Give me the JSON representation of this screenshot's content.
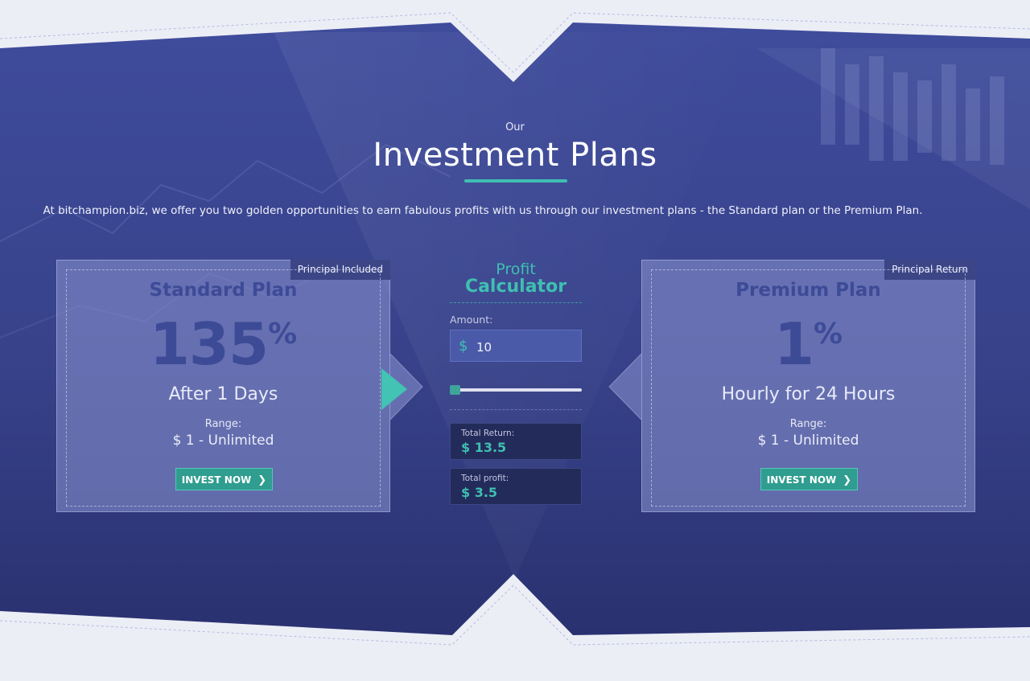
{
  "section": {
    "eyebrow": "Our",
    "title": "Investment Plans",
    "intro": "At bitchampion.biz, we offer you two golden opportunities to earn fabulous profits with us through our investment plans - the Standard plan or the Premium Plan."
  },
  "plans": [
    {
      "badge": "Principal Included",
      "name": "Standard Plan",
      "percent": "135",
      "percent_sign": "%",
      "period": "After 1 Days",
      "range_label": "Range:",
      "range_value": "$ 1 - Unlimited",
      "button": "INVEST NOW"
    },
    {
      "badge": "Principal Return",
      "name": "Premium Plan",
      "percent": "1",
      "percent_sign": "%",
      "period": "Hourly for 24 Hours",
      "range_label": "Range:",
      "range_value": "$ 1 - Unlimited",
      "button": "INVEST NOW"
    }
  ],
  "calculator": {
    "profit_label": "Profit",
    "title": "Calculator",
    "amount_label": "Amount:",
    "currency": "$",
    "amount_value": "10",
    "slider_level": 0.0,
    "total_return_label": "Total Return:",
    "total_return_value": "$ 13.5",
    "total_profit_label": "Total profit:",
    "total_profit_value": "$ 3.5"
  },
  "colors": {
    "accent": "#3fbfb1",
    "panel": "#3d4a96",
    "plan_text": "#3d4b97",
    "badge_bg": "#3c4686",
    "button_bg": "#2f9d8f"
  },
  "icons": {
    "button_chevron": "chevron-right-icon",
    "pointer_arrow": "triangle-right-icon"
  }
}
